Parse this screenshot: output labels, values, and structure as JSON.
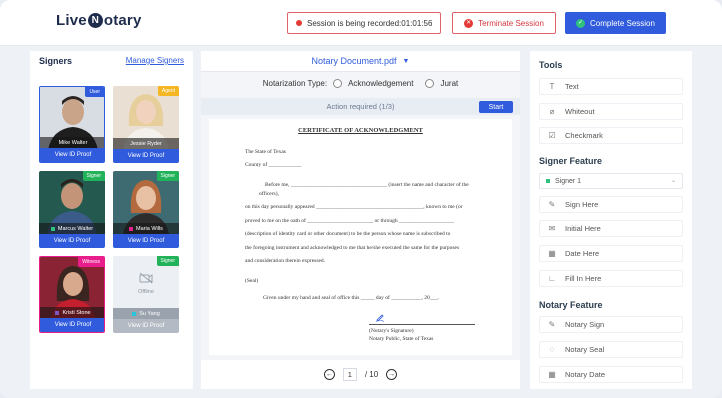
{
  "header": {
    "logo_left": "Live",
    "logo_mid": "N",
    "logo_right": "otary",
    "recording": "Session is being recorded:01:01:56",
    "terminate": "Terminate Session",
    "complete": "Complete Session"
  },
  "signers": {
    "title": "Signers",
    "manage": "Manage Signers",
    "cards": [
      {
        "name": "Mike Walter",
        "tag": "User",
        "tag_color": "#2f5bdc",
        "proof": "View ID Proof",
        "dot": ""
      },
      {
        "name": "Jessie Ryder",
        "tag": "Agent",
        "tag_color": "#f5b623",
        "proof": "View ID Proof",
        "dot": ""
      },
      {
        "name": "Marcus Walter",
        "tag": "Signer",
        "tag_color": "#22b35a",
        "proof": "View ID Proof",
        "dot": "#2ec27e"
      },
      {
        "name": "Maria Wills",
        "tag": "Signer",
        "tag_color": "#22b35a",
        "proof": "View ID Proof",
        "dot": "#e91e8c"
      },
      {
        "name": "Kristi Stone",
        "tag": "Witness",
        "tag_color": "#e91e8c",
        "proof": "View ID Proof",
        "dot": "#7e57c2"
      },
      {
        "name": "Su Yang",
        "tag": "Signer",
        "tag_color": "#22b35a",
        "proof": "View ID Proof",
        "dot": "#26c6da",
        "offline": "Offline"
      }
    ]
  },
  "document": {
    "file": "Notary Document.pdf",
    "type_label": "Notarization Type:",
    "opt1": "Acknowledgement",
    "opt2": "Jurat",
    "action": "Action required (1/3)",
    "start": "Start",
    "title": "CERTIFICATE OF ACKNOWLEDGMENT",
    "lines": [
      "The State of Texas",
      "County of ____________",
      "Before me, ___________________________________ (insert the name and character of the",
      "officers),",
      "on this day personally appeared _______________________________________, known to me (or",
      "proved to me on the oath of ________________________ or through ____________________",
      "(description of identity card or other document) to be the person whose name is subscribed to",
      "the foregoing instrument and acknowledged to me that he/she executed the same for the purposes",
      "and consideration therein expressed.",
      "(Seal)",
      "Given under my hand and seal of office this _____ day of ___________, 20___.",
      "(Notary's Signature)",
      "Notary Public, State of Texas"
    ],
    "page": "1",
    "total": "/ 10"
  },
  "tools": {
    "title": "Tools",
    "items": [
      "Text",
      "Whiteout",
      "Checkmark"
    ],
    "signer_title": "Signer Feature",
    "signer_select": "Signer 1",
    "signer_items": [
      "Sign Here",
      "Initial Here",
      "Date Here",
      "Fill In Here"
    ],
    "notary_title": "Notary Feature",
    "notary_items": [
      "Notary Sign",
      "Notary Seal",
      "Notary Date"
    ]
  }
}
